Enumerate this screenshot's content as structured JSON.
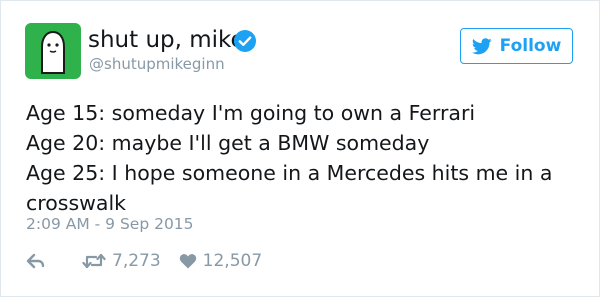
{
  "user": {
    "display_name": "shut up, mike",
    "handle": "@shutupmikeginn",
    "verified": true,
    "avatar": "ghost-figure-avatar"
  },
  "follow_button": {
    "label": "Follow",
    "icon": "twitter-bird-icon"
  },
  "tweet": {
    "lines": [
      "Age 15: someday I'm going to own a Ferrari",
      "Age 20: maybe I'll get a BMW someday",
      "Age 25: I hope someone in a Mercedes hits me in a",
      "crosswalk"
    ],
    "timestamp": "2:09 AM - 9 Sep 2015"
  },
  "actions": {
    "reply": {
      "icon": "reply-icon"
    },
    "retweet": {
      "icon": "retweet-icon",
      "count": "7,273"
    },
    "like": {
      "icon": "heart-icon",
      "count": "12,507"
    }
  },
  "colors": {
    "accent": "#1da1f2",
    "avatar_bg": "#2fb24c",
    "muted_text": "#8899a6",
    "text": "#14171a",
    "border": "#e1e8ed"
  }
}
